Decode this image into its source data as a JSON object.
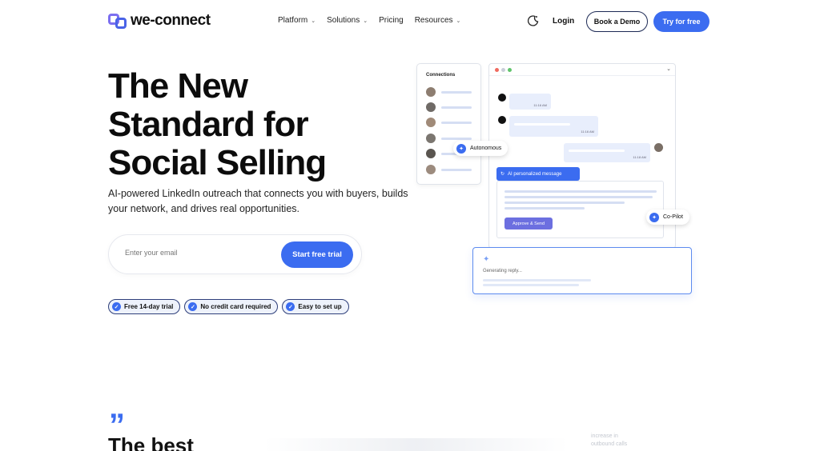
{
  "brand": {
    "name": "we-connect"
  },
  "nav": {
    "items": [
      {
        "label": "Platform",
        "has_dropdown": true
      },
      {
        "label": "Solutions",
        "has_dropdown": true
      },
      {
        "label": "Pricing",
        "has_dropdown": false
      },
      {
        "label": "Resources",
        "has_dropdown": true
      }
    ],
    "login": "Login",
    "book_demo": "Book a Demo",
    "try_free": "Try for free"
  },
  "hero": {
    "title_lines": [
      "The New",
      "Standard for",
      "Social Selling"
    ],
    "subtitle": "AI-powered LinkedIn outreach that connects you with buyers, builds your network, and drives real opportunities.",
    "email_placeholder": "Enter your email",
    "cta": "Start free trial",
    "badges": [
      "Free 14-day trial",
      "No credit card required",
      "Easy to set up"
    ]
  },
  "illustration": {
    "connections_title": "Connections",
    "messages": [
      {
        "time": "11:16 AM"
      },
      {
        "time": "11:16 AM"
      },
      {
        "time": "11:18 AM"
      }
    ],
    "autonomous_label": "Autonomous",
    "ai_tag": "AI personalized message",
    "approve_label": "Approve & Send",
    "copilot_label": "Co-Pilot",
    "generating": "Generating reply..."
  },
  "testimonial": {
    "heading_partial": "The best",
    "stat_partial": [
      "increase in",
      "outbound calls"
    ]
  },
  "colors": {
    "accent": "#3b6cf0",
    "dark": "#0c0c0c",
    "badge_bg": "#eef2fb"
  }
}
